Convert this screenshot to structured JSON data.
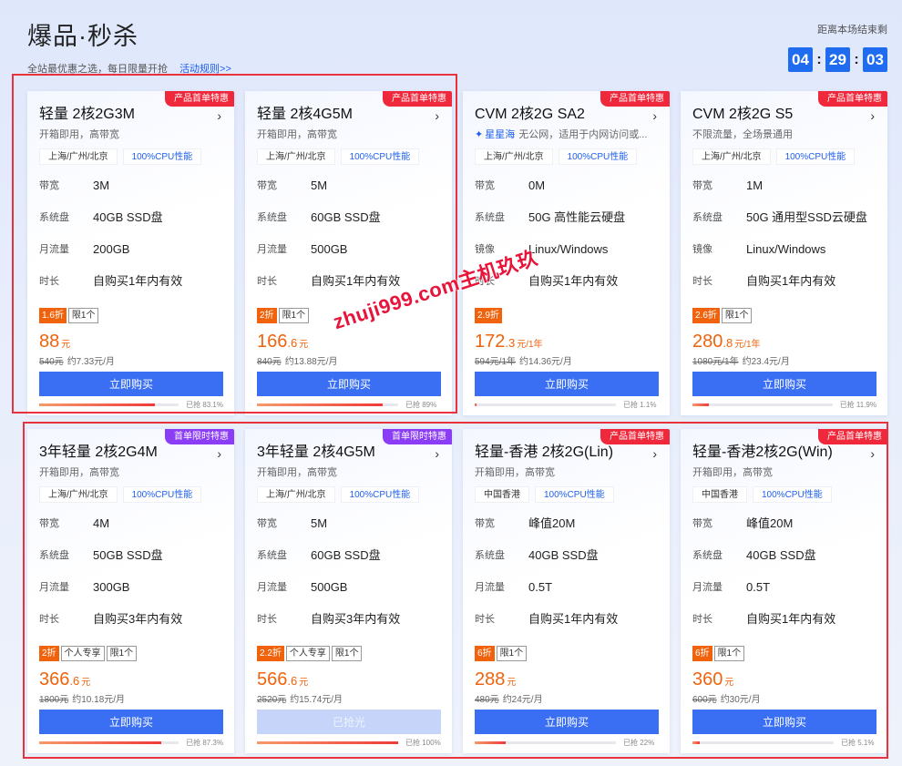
{
  "header": {
    "title": "爆品·秒杀",
    "subtitle": "全站最优惠之选，每日限量开抢",
    "rules_link": "活动规则>>"
  },
  "countdown": {
    "label": "距离本场结束剩",
    "hours": "04",
    "minutes": "29",
    "seconds": "03",
    "sep": ":"
  },
  "watermark": "zhuji999.com主机玖玖",
  "cards": [
    {
      "badge": "产品首单特惠",
      "badge_color": "#f0283c",
      "name": "轻量 2核2G3M",
      "desc": "开箱即用，高带宽",
      "brand": "",
      "tags": [
        "上海/广州/北京",
        "100%CPU性能"
      ],
      "specs": [
        {
          "label": "带宽",
          "value": "3M"
        },
        {
          "label": "系统盘",
          "value": "40GB SSD盘"
        },
        {
          "label": "月流量",
          "value": "200GB"
        },
        {
          "label": "时长",
          "value": "自购买1年内有效"
        }
      ],
      "discount": "1.6折",
      "labels": [
        "限1个"
      ],
      "price_int": "88",
      "price_dec": "",
      "price_unit": "元",
      "orig_price": "540元",
      "per_month": "约7.33元/月",
      "button": "立即购买",
      "button_disabled": false,
      "sold_text": "已抢 83.1%",
      "sold_ratio": 0.831
    },
    {
      "badge": "产品首单特惠",
      "badge_color": "#f0283c",
      "name": "轻量 2核4G5M",
      "desc": "开箱即用，高带宽",
      "brand": "",
      "tags": [
        "上海/广州/北京",
        "100%CPU性能"
      ],
      "specs": [
        {
          "label": "带宽",
          "value": "5M"
        },
        {
          "label": "系统盘",
          "value": "60GB SSD盘"
        },
        {
          "label": "月流量",
          "value": "500GB"
        },
        {
          "label": "时长",
          "value": "自购买1年内有效"
        }
      ],
      "discount": "2折",
      "labels": [
        "限1个"
      ],
      "price_int": "166",
      "price_dec": ".6",
      "price_unit": "元",
      "orig_price": "840元",
      "per_month": "约13.88元/月",
      "button": "立即购买",
      "button_disabled": false,
      "sold_text": "已抢 89%",
      "sold_ratio": 0.89
    },
    {
      "badge": "产品首单特惠",
      "badge_color": "#f0283c",
      "name": "CVM 2核2G SA2",
      "desc": "无公网，适用于内网访问或...",
      "brand": "星星海",
      "tags": [
        "上海/广州/北京",
        "100%CPU性能"
      ],
      "specs": [
        {
          "label": "带宽",
          "value": "0M"
        },
        {
          "label": "系统盘",
          "value": "50G 高性能云硬盘"
        },
        {
          "label": "镜像",
          "value": "Linux/Windows"
        },
        {
          "label": "时长",
          "value": "自购买1年内有效"
        }
      ],
      "discount": "2.9折",
      "labels": [],
      "price_int": "172",
      "price_dec": ".3",
      "price_unit": "元/1年",
      "orig_price": "594元/1年",
      "per_month": "约14.36元/月",
      "button": "立即购买",
      "button_disabled": false,
      "sold_text": "已抢 1.1%",
      "sold_ratio": 0.011
    },
    {
      "badge": "产品首单特惠",
      "badge_color": "#f0283c",
      "name": "CVM 2核2G S5",
      "desc": "不限流量，全场景通用",
      "brand": "",
      "tags": [
        "上海/广州/北京",
        "100%CPU性能"
      ],
      "specs": [
        {
          "label": "带宽",
          "value": "1M"
        },
        {
          "label": "系统盘",
          "value": "50G 通用型SSD云硬盘"
        },
        {
          "label": "镜像",
          "value": "Linux/Windows"
        },
        {
          "label": "时长",
          "value": "自购买1年内有效"
        }
      ],
      "discount": "2.6折",
      "labels": [
        "限1个"
      ],
      "price_int": "280",
      "price_dec": ".8",
      "price_unit": "元/1年",
      "orig_price": "1080元/1年",
      "per_month": "约23.4元/月",
      "button": "立即购买",
      "button_disabled": false,
      "sold_text": "已抢 11.9%",
      "sold_ratio": 0.119
    },
    {
      "badge": "首单限时特惠",
      "badge_color": "#8b3cf5",
      "name": "3年轻量 2核2G4M",
      "desc": "开箱即用，高带宽",
      "brand": "",
      "tags": [
        "上海/广州/北京",
        "100%CPU性能"
      ],
      "specs": [
        {
          "label": "带宽",
          "value": "4M"
        },
        {
          "label": "系统盘",
          "value": "50GB SSD盘"
        },
        {
          "label": "月流量",
          "value": "300GB"
        },
        {
          "label": "时长",
          "value": "自购买3年内有效"
        }
      ],
      "discount": "2折",
      "labels": [
        "个人专享",
        "限1个"
      ],
      "price_int": "366",
      "price_dec": ".6",
      "price_unit": "元",
      "orig_price": "1800元",
      "per_month": "约10.18元/月",
      "button": "立即购买",
      "button_disabled": false,
      "sold_text": "已抢 87.3%",
      "sold_ratio": 0.873
    },
    {
      "badge": "首单限时特惠",
      "badge_color": "#8b3cf5",
      "name": "3年轻量 2核4G5M",
      "desc": "开箱即用，高带宽",
      "brand": "",
      "tags": [
        "上海/广州/北京",
        "100%CPU性能"
      ],
      "specs": [
        {
          "label": "带宽",
          "value": "5M"
        },
        {
          "label": "系统盘",
          "value": "60GB SSD盘"
        },
        {
          "label": "月流量",
          "value": "500GB"
        },
        {
          "label": "时长",
          "value": "自购买3年内有效"
        }
      ],
      "discount": "2.2折",
      "labels": [
        "个人专享",
        "限1个"
      ],
      "price_int": "566",
      "price_dec": ".6",
      "price_unit": "元",
      "orig_price": "2520元",
      "per_month": "约15.74元/月",
      "button": "已抢光",
      "button_disabled": true,
      "sold_text": "已抢 100%",
      "sold_ratio": 1.0
    },
    {
      "badge": "产品首单特惠",
      "badge_color": "#f0283c",
      "name": "轻量-香港 2核2G(Lin)",
      "desc": "开箱即用，高带宽",
      "brand": "",
      "tags": [
        "中国香港",
        "100%CPU性能"
      ],
      "specs": [
        {
          "label": "带宽",
          "value": "峰值20M"
        },
        {
          "label": "系统盘",
          "value": "40GB SSD盘"
        },
        {
          "label": "月流量",
          "value": "0.5T"
        },
        {
          "label": "时长",
          "value": "自购买1年内有效"
        }
      ],
      "discount": "6折",
      "labels": [
        "限1个"
      ],
      "price_int": "288",
      "price_dec": "",
      "price_unit": "元",
      "orig_price": "480元",
      "per_month": "约24元/月",
      "button": "立即购买",
      "button_disabled": false,
      "sold_text": "已抢 22%",
      "sold_ratio": 0.22
    },
    {
      "badge": "产品首单特惠",
      "badge_color": "#f0283c",
      "name": "轻量-香港2核2G(Win)",
      "desc": "开箱即用，高带宽",
      "brand": "",
      "tags": [
        "中国香港",
        "100%CPU性能"
      ],
      "specs": [
        {
          "label": "带宽",
          "value": "峰值20M"
        },
        {
          "label": "系统盘",
          "value": "40GB SSD盘"
        },
        {
          "label": "月流量",
          "value": "0.5T"
        },
        {
          "label": "时长",
          "value": "自购买1年内有效"
        }
      ],
      "discount": "6折",
      "labels": [
        "限1个"
      ],
      "price_int": "360",
      "price_dec": "",
      "price_unit": "元",
      "orig_price": "600元",
      "per_month": "约30元/月",
      "button": "立即购买",
      "button_disabled": false,
      "sold_text": "已抢 5.1%",
      "sold_ratio": 0.051
    }
  ]
}
